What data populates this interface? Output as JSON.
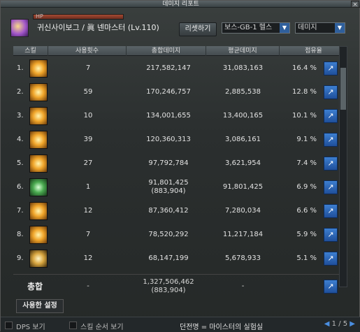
{
  "window": {
    "title": "데미지 리포트",
    "close_label": "×"
  },
  "header": {
    "hp_label": "HP",
    "character": "귀신사이보그 / 眞 넨마스터 (Lv.110)",
    "reset_label": "리셋하기",
    "boss_select": "보스-GB-1 헬스",
    "type_select": "데미지"
  },
  "columns": [
    "스킬",
    "사용횟수",
    "총합데미지",
    "평균데미지",
    "점유율"
  ],
  "rows": [
    {
      "rank": "1.",
      "uses": "7",
      "total": "217,582,147",
      "total_sub": "",
      "avg": "31,083,163",
      "share": "16.4 %"
    },
    {
      "rank": "2.",
      "uses": "59",
      "total": "170,246,757",
      "total_sub": "",
      "avg": "2,885,538",
      "share": "12.8 %"
    },
    {
      "rank": "3.",
      "uses": "10",
      "total": "134,001,655",
      "total_sub": "",
      "avg": "13,400,165",
      "share": "10.1 %"
    },
    {
      "rank": "4.",
      "uses": "39",
      "total": "120,360,313",
      "total_sub": "",
      "avg": "3,086,161",
      "share": "9.1 %"
    },
    {
      "rank": "5.",
      "uses": "27",
      "total": "97,792,784",
      "total_sub": "",
      "avg": "3,621,954",
      "share": "7.4 %"
    },
    {
      "rank": "6.",
      "uses": "1",
      "total": "91,801,425",
      "total_sub": "(883,904)",
      "avg": "91,801,425",
      "share": "6.9 %"
    },
    {
      "rank": "7.",
      "uses": "12",
      "total": "87,360,412",
      "total_sub": "",
      "avg": "7,280,034",
      "share": "6.6 %"
    },
    {
      "rank": "8.",
      "uses": "7",
      "total": "78,520,292",
      "total_sub": "",
      "avg": "11,217,184",
      "share": "5.9 %"
    },
    {
      "rank": "9.",
      "uses": "12",
      "total": "68,147,199",
      "total_sub": "",
      "avg": "5,678,933",
      "share": "5.1 %"
    }
  ],
  "total": {
    "label": "총합",
    "uses": "-",
    "total": "1,327,506,462",
    "total_sub": "(883,904)",
    "avg": "-"
  },
  "tabs": {
    "used_setting": "사용한 설정"
  },
  "footer": {
    "dps_label": "DPS 보기",
    "order_label": "스킬 순서 보기",
    "dungeon": "던전명 = 마이스터의 실험실",
    "page": "1 / 5"
  },
  "colors": {
    "accent": "#2f5f9c",
    "share_button": "#3d7fd0"
  }
}
